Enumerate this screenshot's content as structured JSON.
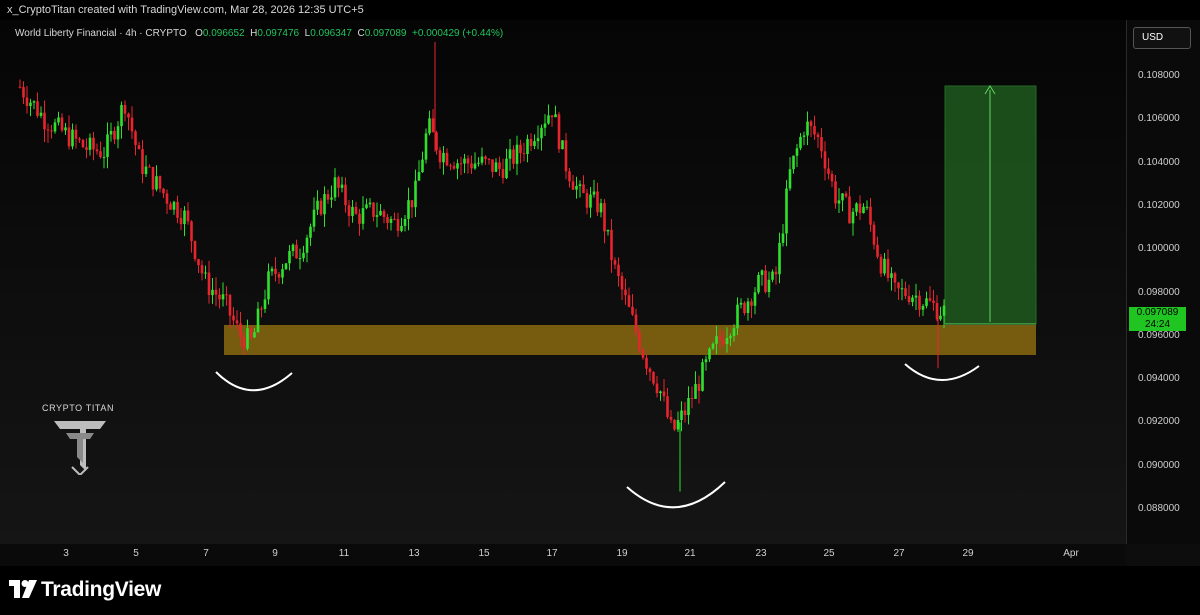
{
  "header": {
    "attribution": "x_CryptoTitan created with TradingView.com, Mar 28, 2026 12:35 UTC+5"
  },
  "legend": {
    "symbol": "World Liberty Financial · 4h · CRYPTO",
    "open_key": "O",
    "open": "0.096652",
    "high_key": "H",
    "high": "0.097476",
    "low_key": "L",
    "low": "0.096347",
    "close_key": "C",
    "close": "0.097089",
    "change": "+0.000429 (+0.44%)"
  },
  "currency": "USD",
  "price_axis": [
    "0.108000",
    "0.106000",
    "0.104000",
    "0.102000",
    "0.100000",
    "0.098000",
    "0.096000",
    "0.094000",
    "0.092000",
    "0.090000",
    "0.088000"
  ],
  "time_axis": [
    "3",
    "5",
    "7",
    "9",
    "11",
    "13",
    "15",
    "17",
    "19",
    "21",
    "23",
    "25",
    "27",
    "29",
    "Apr"
  ],
  "last_price": {
    "value": "0.097089",
    "countdown": "24:24"
  },
  "brand": {
    "name": "CRYPTO TITAN"
  },
  "footer": {
    "logo_text": "TradingView"
  },
  "colors": {
    "up": "#2ee12e",
    "down": "#e8242e",
    "zone": "#8a6a10",
    "target": "#1f5a1f",
    "accent": "#21c521"
  }
}
